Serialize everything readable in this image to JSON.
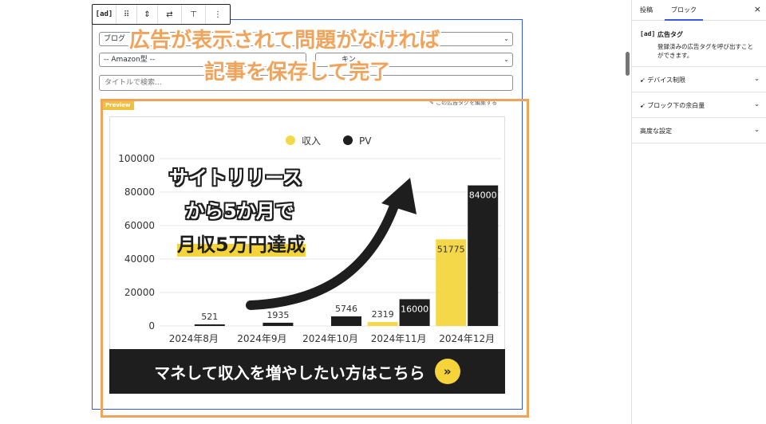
{
  "toolbar": {
    "block_icon": "[ad]",
    "drag_icon": "⠿",
    "move_icon": "⇕",
    "transform_icon": "⇄",
    "align_icon": "⊤",
    "more_icon": "⋮"
  },
  "form": {
    "select_category": "ブログ",
    "select_rank_partial": "キン",
    "select_type": "-- Amazon型 --",
    "search_placeholder": "タイトルで検索..."
  },
  "annotation": {
    "line1": "広告が表示されて問題がなければ",
    "line2": "記事を保存して完了"
  },
  "preview": {
    "tag": "Preview",
    "edit_link": "この広告タグを編集する"
  },
  "ad": {
    "overlay_line1": "サイトリリース",
    "overlay_line2": "から5か月で",
    "overlay_line3": "月収5万円達成",
    "banner_text": "マネして収入を増やしたい方はこちら",
    "banner_arrow": "»"
  },
  "chart_data": {
    "type": "bar",
    "categories": [
      "2024年8月",
      "2024年9月",
      "2024年10月",
      "2024年11月",
      "2024年12月"
    ],
    "series": [
      {
        "name": "収入",
        "color": "#f5d84a",
        "values": [
          0,
          0,
          0,
          2319,
          51775
        ]
      },
      {
        "name": "PV",
        "color": "#1e1e1e",
        "values": [
          521,
          1935,
          5746,
          16000,
          84000
        ]
      }
    ],
    "data_labels": [
      [
        "",
        "",
        "",
        "2319",
        "51775"
      ],
      [
        "521",
        "1935",
        "5746",
        "16000",
        "84000"
      ]
    ],
    "yticks": [
      "0",
      "20000",
      "40000",
      "60000",
      "80000",
      "100000"
    ],
    "ylim": [
      0,
      100000
    ],
    "legend_position": "top"
  },
  "sidebar": {
    "tab_post": "投稿",
    "tab_block": "ブロック",
    "close": "×",
    "block_code": "[ad]",
    "block_name": "広告タグ",
    "block_desc": "登録済みの広告タグを呼び出すことができます。",
    "panels": [
      "デバイス制限",
      "ブロック下の余白量",
      "高度な設定"
    ]
  }
}
